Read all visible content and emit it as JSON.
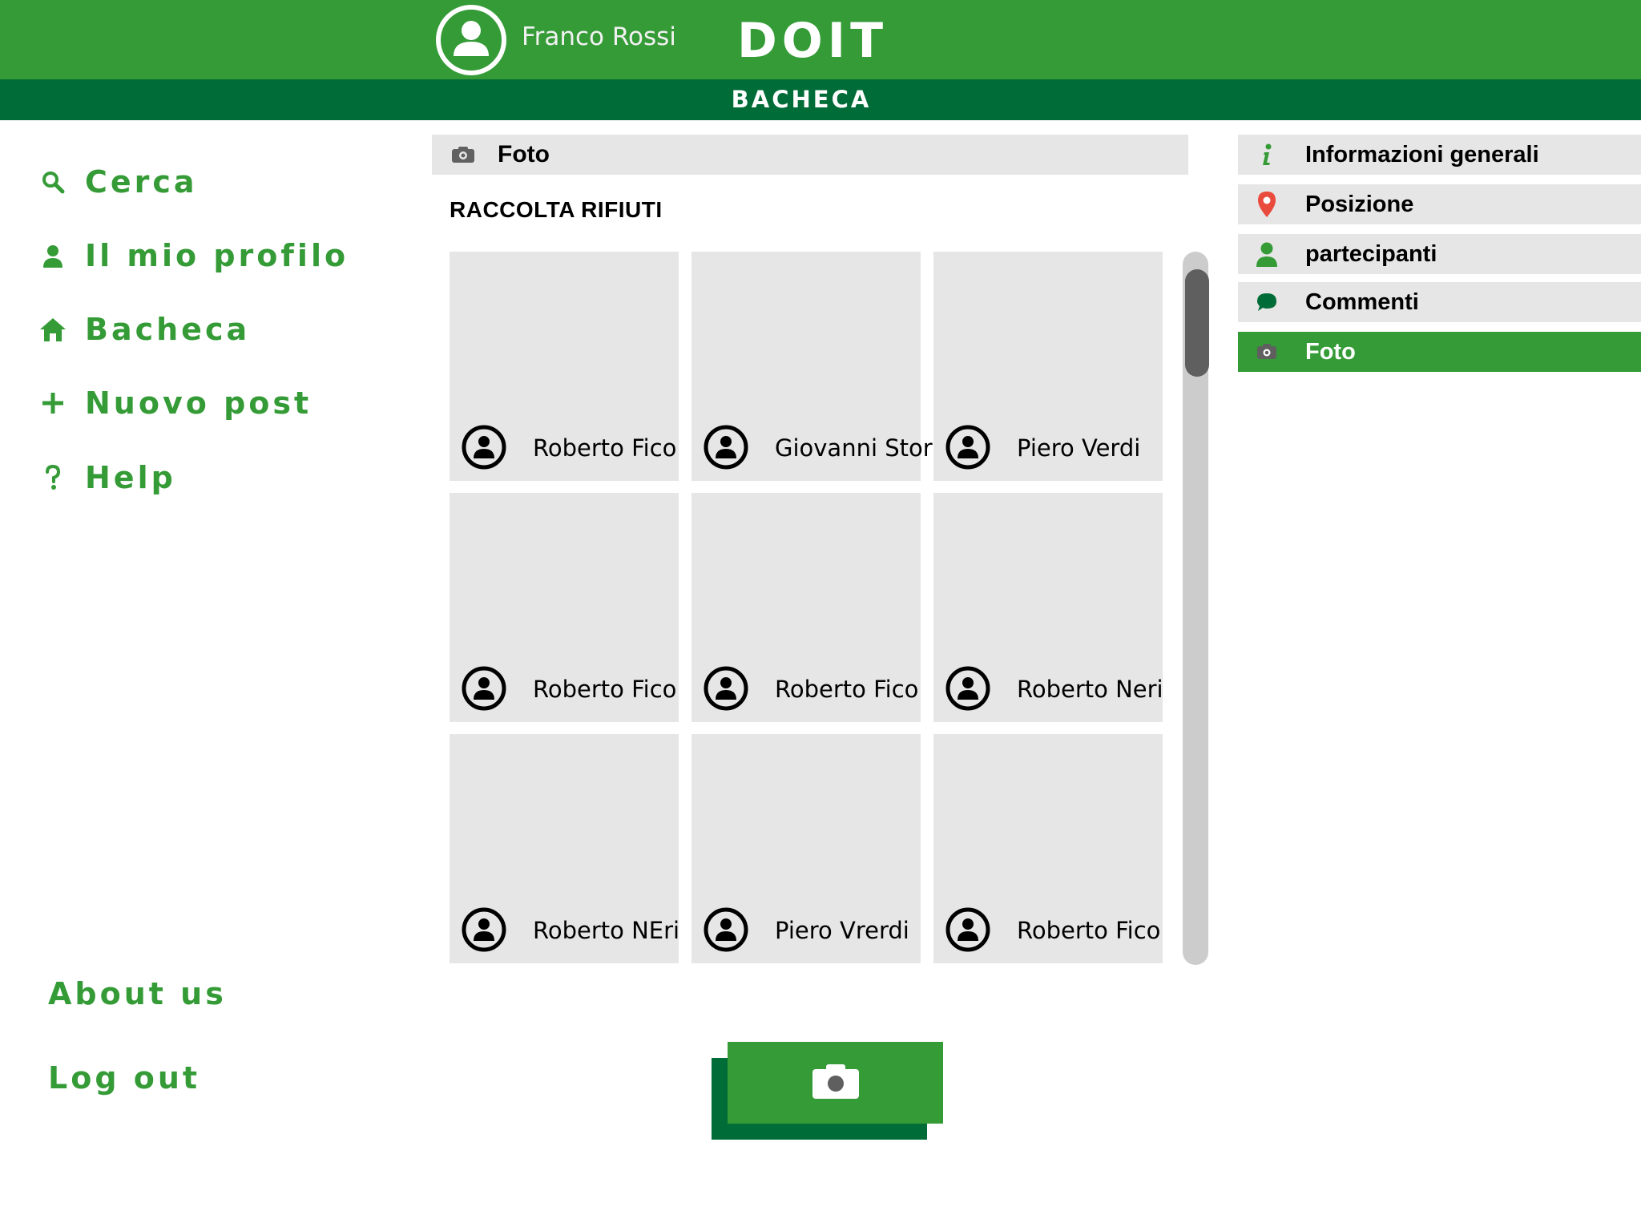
{
  "header": {
    "user_name": "Franco Rossi",
    "app_title": "DOIT",
    "section_title": "BACHECA"
  },
  "sidebar": {
    "items": [
      {
        "label": "Cerca",
        "icon": "search-icon"
      },
      {
        "label": "Il mio profilo",
        "icon": "user-icon"
      },
      {
        "label": "Bacheca",
        "icon": "home-icon"
      },
      {
        "label": "Nuovo post",
        "icon": "plus-icon"
      },
      {
        "label": "Help",
        "icon": "help-icon"
      }
    ],
    "about_label": "About us",
    "logout_label": "Log out"
  },
  "main": {
    "strip_label": "Foto",
    "post_title": "RACCOLTA RIFIUTI",
    "photos": [
      {
        "author": "Roberto Fico"
      },
      {
        "author": "Giovanni Stor"
      },
      {
        "author": "Piero Verdi"
      },
      {
        "author": "Roberto Fico"
      },
      {
        "author": "Roberto Fico"
      },
      {
        "author": "Roberto Neri"
      },
      {
        "author": "Roberto NEri"
      },
      {
        "author": "Piero Vrerdi"
      },
      {
        "author": "Roberto Fico"
      }
    ],
    "camera_button_icon": "camera-icon"
  },
  "right_menu": {
    "items": [
      {
        "label": "Informazioni generali",
        "icon": "info-icon"
      },
      {
        "label": "Posizione",
        "icon": "location-pin-icon"
      },
      {
        "label": "partecipanti",
        "icon": "user-icon"
      },
      {
        "label": "Commenti",
        "icon": "comment-icon"
      },
      {
        "label": "Foto",
        "icon": "camera-icon",
        "active": true
      }
    ]
  },
  "colors": {
    "primary_green": "#349b36",
    "dark_green": "#006c37",
    "tile_gray": "#e6e6e6",
    "pin_red": "#e94b3c"
  }
}
